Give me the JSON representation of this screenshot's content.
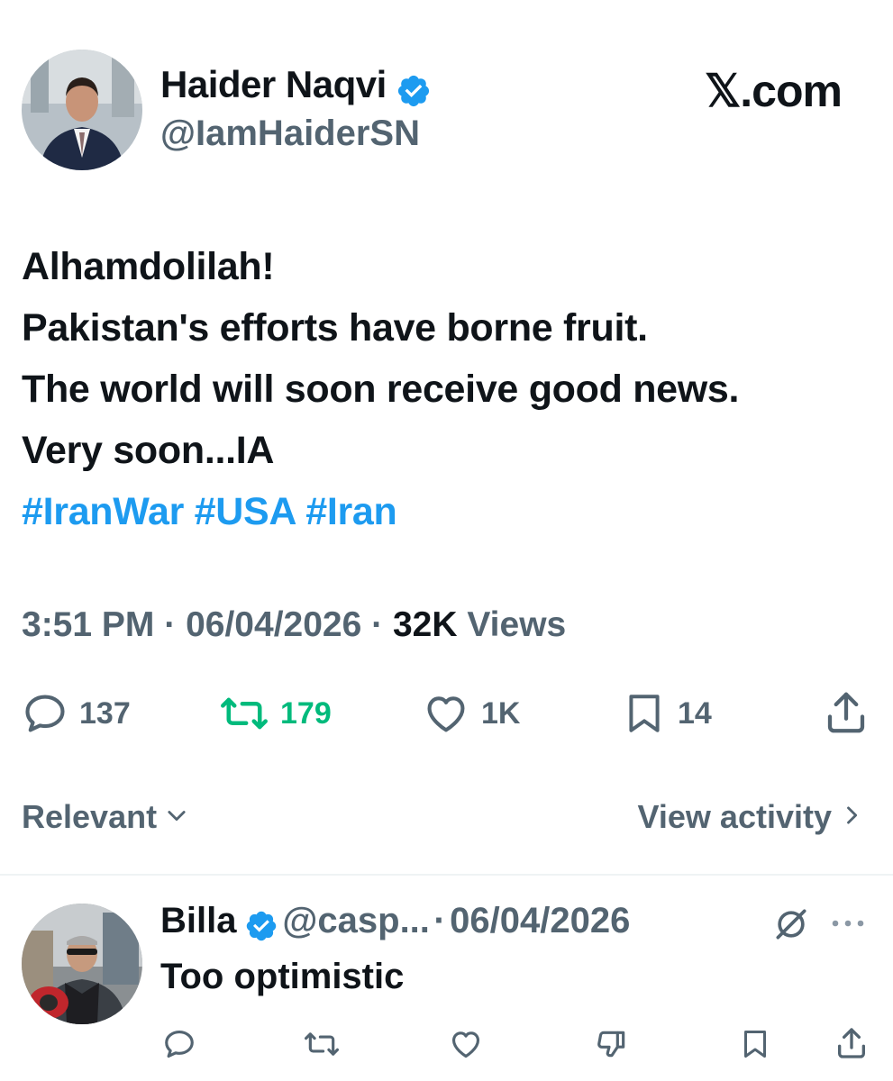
{
  "brand": {
    "site_label": "𝕏.com"
  },
  "post": {
    "author": {
      "name": "Haider Naqvi",
      "handle": "@IamHaiderSN",
      "verified_icon": "verified-badge-icon"
    },
    "lines": [
      "Alhamdolilah!",
      "Pakistan's efforts have borne fruit.",
      "The world will soon receive good news.",
      "Very soon...IA"
    ],
    "hashtags": [
      "#IranWar",
      "#USA",
      "#Iran"
    ],
    "meta": {
      "time": "3:51 PM",
      "sep1": "·",
      "date": "06/04/2026",
      "sep2": "·",
      "views_count": "32K",
      "views_label": "Views"
    },
    "actions": {
      "replies": "137",
      "reposts": "179",
      "likes": "1K",
      "bookmarks": "14"
    }
  },
  "filters": {
    "sort_label": "Relevant",
    "activity_label": "View activity"
  },
  "reply": {
    "author": {
      "name": "Billa",
      "handle": "@casp...",
      "sep": "·",
      "date": "06/04/2026"
    },
    "text": "Too optimistic"
  },
  "colors": {
    "accent": "#1d9bf0",
    "repost_active": "#00ba7c",
    "secondary_text": "#536471",
    "primary_text": "#0f1419"
  }
}
